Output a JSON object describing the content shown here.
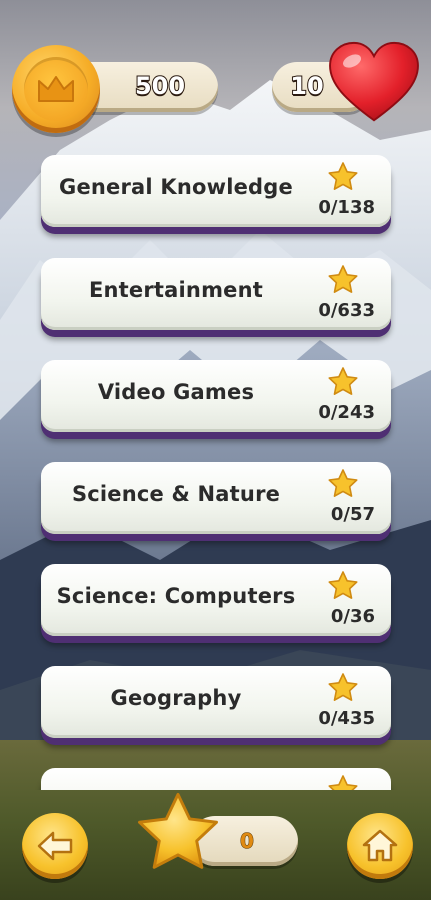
{
  "header": {
    "coins": "500",
    "lives": "10",
    "coin_icon": "crown-coin-icon",
    "lives_icon": "heart-icon"
  },
  "categories": [
    {
      "name": "General Knowledge",
      "progress": "0/138"
    },
    {
      "name": "Entertainment",
      "progress": "0/633"
    },
    {
      "name": "Video Games",
      "progress": "0/243"
    },
    {
      "name": "Science & Nature",
      "progress": "0/57"
    },
    {
      "name": "Science: Computers",
      "progress": "0/36"
    },
    {
      "name": "Geography",
      "progress": "0/435"
    }
  ],
  "footer": {
    "stars": "0",
    "back_icon": "arrow-left-icon",
    "home_icon": "home-icon",
    "star_icon": "star-icon"
  },
  "colors": {
    "card_shadow": "#4f2f73",
    "gold": "#f6ad27",
    "heart": "#e3202a"
  }
}
